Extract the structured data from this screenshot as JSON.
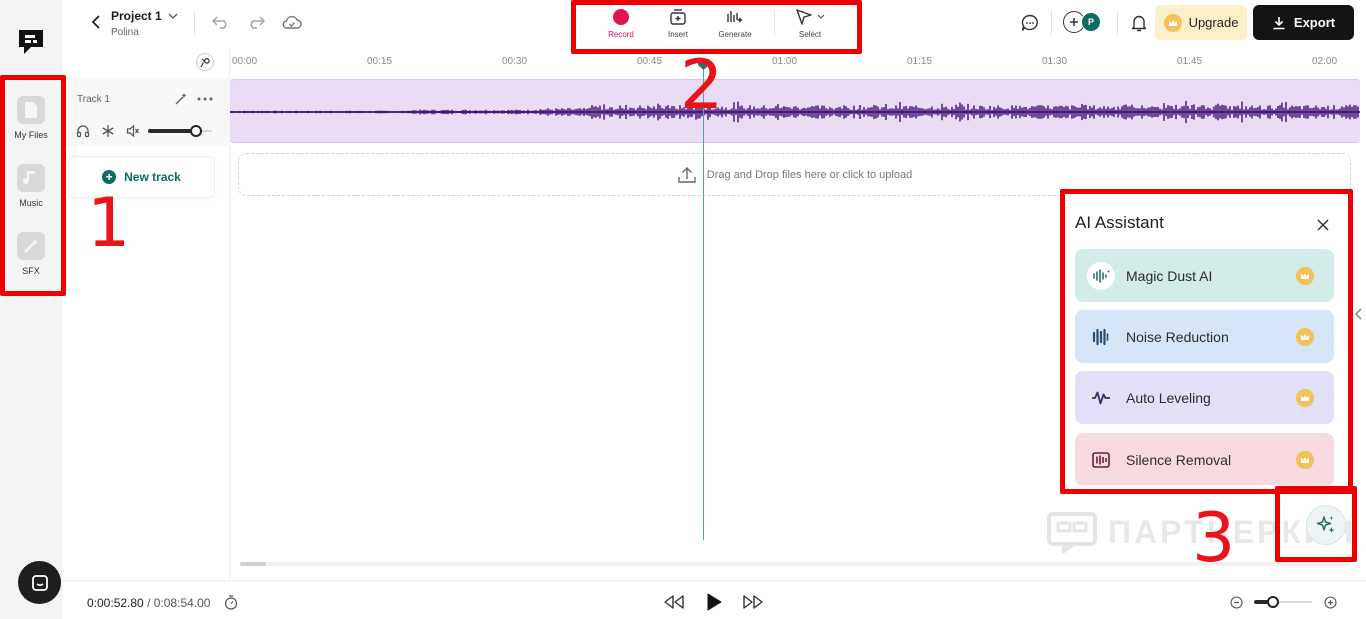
{
  "app": {
    "project_name": "Project 1",
    "owner": "Polina"
  },
  "sidebar": {
    "items": [
      {
        "label": "My Files",
        "icon": "file-icon"
      },
      {
        "label": "Music",
        "icon": "music-note-icon"
      },
      {
        "label": "SFX",
        "icon": "magic-wand-icon"
      }
    ]
  },
  "toolbar": {
    "tools": [
      {
        "label": "Record",
        "icon": "record-icon"
      },
      {
        "label": "Insert",
        "icon": "insert-icon"
      },
      {
        "label": "Generate",
        "icon": "generate-icon"
      },
      {
        "label": "Select",
        "icon": "cursor-icon"
      }
    ],
    "avatar_initial": "P",
    "upgrade_label": "Upgrade",
    "export_label": "Export"
  },
  "ruler": {
    "ticks": [
      "00:00",
      "00:15",
      "00:30",
      "00:45",
      "01:00",
      "01:15",
      "01:30",
      "01:45",
      "02:00"
    ]
  },
  "tracks": [
    {
      "name": "Track 1",
      "volume": 0.75
    }
  ],
  "new_track_label": "New track",
  "upload_hint": "Drag and Drop files here or click to upload",
  "playback": {
    "current_time": "0:00:52.80",
    "separator": "/",
    "total_time": "0:08:54.00",
    "zoom_level": 0.32,
    "scroll_position": 0.0
  },
  "ai_assistant": {
    "title": "AI Assistant",
    "items": [
      {
        "label": "Magic Dust AI",
        "icon": "magic-dust-icon",
        "bg": "#d3ebe9",
        "iconbg": "#ffffff",
        "iconcolor": "#2f6e6a"
      },
      {
        "label": "Noise Reduction",
        "icon": "noise-reduction-icon",
        "bg": "#d6e6f8",
        "iconbg": "#d6e6f8",
        "iconcolor": "#2b4d73"
      },
      {
        "label": "Auto Leveling",
        "icon": "auto-leveling-icon",
        "bg": "#e2e0f6",
        "iconbg": "#e2e0f6",
        "iconcolor": "#3a2f6b"
      },
      {
        "label": "Silence Removal",
        "icon": "silence-removal-icon",
        "bg": "#f8dbe0",
        "iconbg": "#f8dbe0",
        "iconcolor": "#6b1f2d"
      }
    ]
  },
  "watermark": "ПАРТНЕРКИН",
  "annotations": [
    "1",
    "2",
    "3"
  ],
  "colors": {
    "accent": "#0f6b5f",
    "record": "#e0174f",
    "waveform": "#3b0a73",
    "clip_bg": "#ebdcf5",
    "playhead": "#4aa4b3",
    "annotation": "#ee0000"
  }
}
